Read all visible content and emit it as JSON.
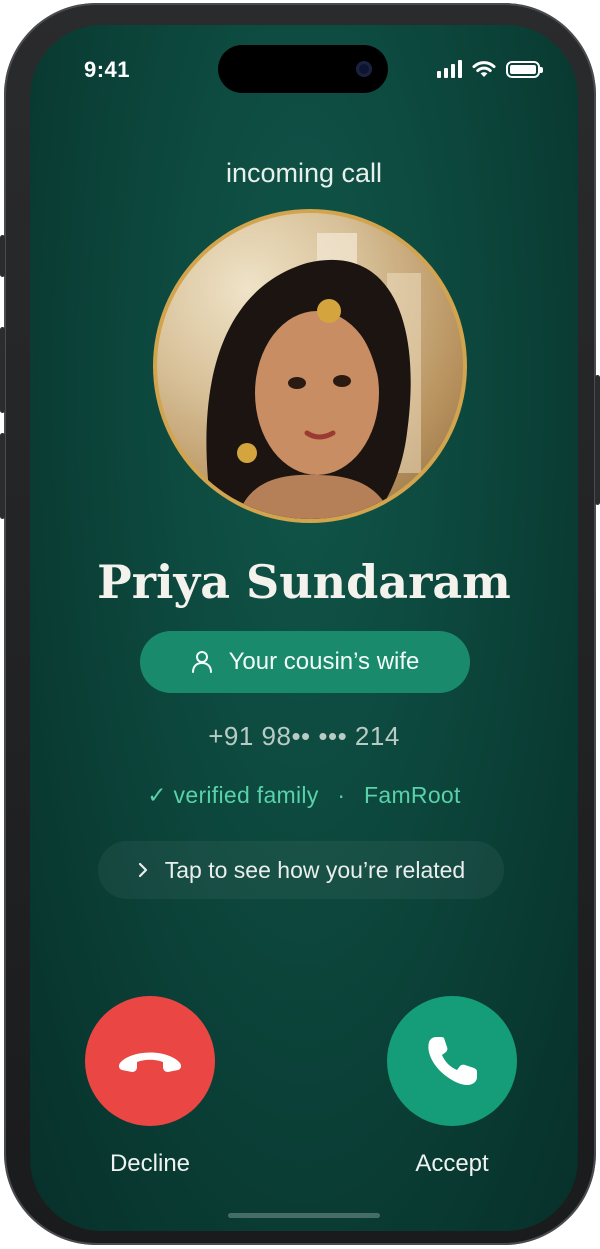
{
  "status_bar": {
    "time": "9:41",
    "icons": [
      "cellular-signal-icon",
      "wifi-icon",
      "battery-icon"
    ]
  },
  "call": {
    "status_label": "incoming call",
    "caller_name": "Priya Sundaram",
    "relation": "Your cousin’s wife",
    "phone_number": "+91 98•• ••• 214",
    "verified_label": "verified family",
    "verified_separator": "·",
    "verified_source": "FamRoot",
    "relation_link": "Tap to see how you’re related"
  },
  "actions": {
    "decline_label": "Decline",
    "accept_label": "Accept"
  },
  "colors": {
    "background": "#0c463c",
    "accent": "#1a8a6d",
    "verified": "#59d1a9",
    "decline": "#ea4744",
    "accept": "#159c78",
    "avatar_ring": "#d2a44e"
  }
}
